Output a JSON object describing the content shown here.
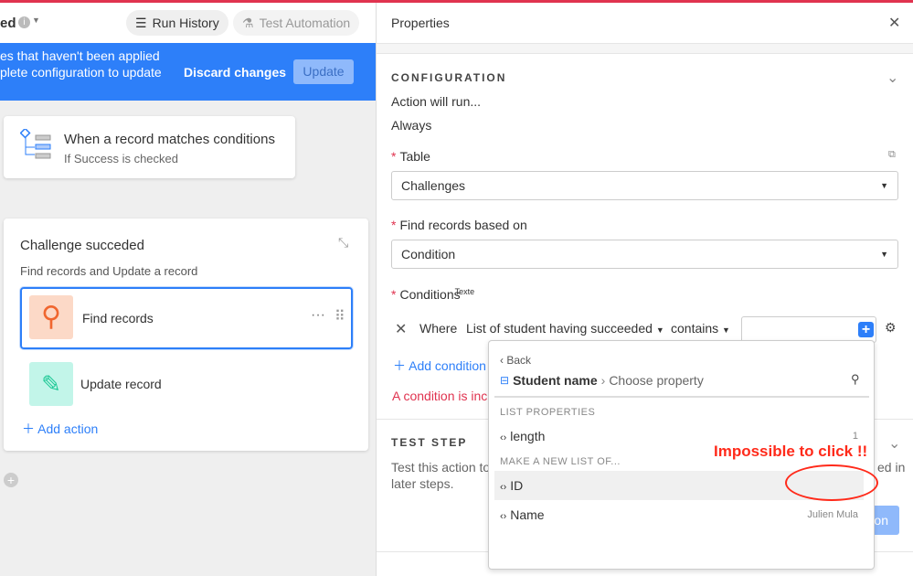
{
  "header": {
    "title_fragment": "ed",
    "run_history": "Run History",
    "test_automation": "Test Automation"
  },
  "banner": {
    "line1": "es that haven't been applied",
    "line2": "plete configuration to update",
    "discard": "Discard changes",
    "update": "Update"
  },
  "trigger": {
    "title": "When a record matches conditions",
    "subtitle": "If Success is checked"
  },
  "action_group": {
    "title": "Challenge succeded",
    "subtitle": "Find records and Update a record",
    "actions": [
      {
        "label": "Find records"
      },
      {
        "label": "Update record"
      }
    ],
    "add_action": "Add action"
  },
  "properties": {
    "title": "Properties",
    "configuration": "CONFIGURATION",
    "action_will_run": "Action will run...",
    "always": "Always",
    "table_label": "Table",
    "table_value": "Challenges",
    "find_label": "Find records based on",
    "find_value": "Condition",
    "conditions_label": "Conditions",
    "conditions_overlay": "Texte",
    "where": "Where",
    "field": "List of student having succeeded",
    "operator": "contains",
    "add_condition": "Add condition",
    "error": "A condition is inc",
    "test_step": "TEST STEP",
    "test_text1": "Test this action to",
    "test_text1_end": "ed in",
    "test_text2": "later steps.",
    "test_btn_fragment": "on"
  },
  "popup": {
    "back": "Back",
    "crumb_main": "Student name",
    "crumb_sep": "›",
    "crumb_sub": "Choose property",
    "group1": "LIST PROPERTIES",
    "group2": "MAKE A NEW LIST OF...",
    "items": [
      {
        "label": "length",
        "value": "1"
      },
      {
        "label": "ID",
        "value": ""
      },
      {
        "label": "Name",
        "value": "Julien Mula"
      }
    ]
  },
  "annotation": {
    "text": "Impossible to click !!",
    "color": "#ff2a1a"
  },
  "colors": {
    "accent": "#2d7ff9",
    "error": "#e0334f"
  }
}
